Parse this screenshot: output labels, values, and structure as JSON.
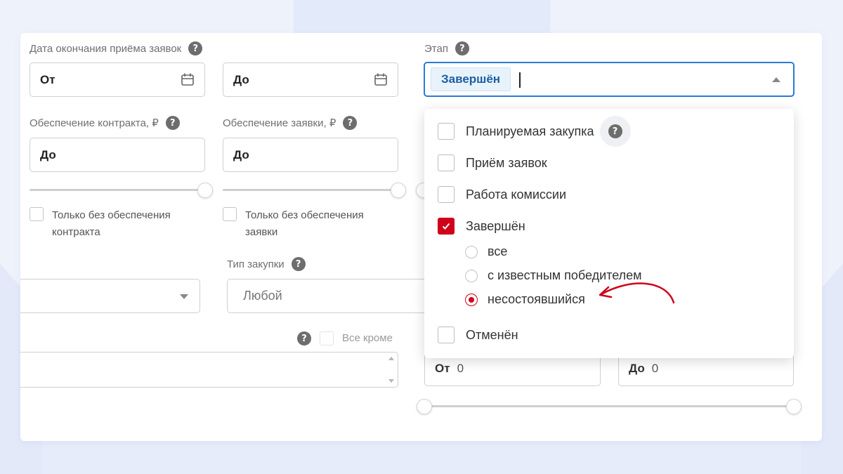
{
  "filters": {
    "deadline": {
      "label": "Дата окончания приёма заявок",
      "from_placeholder": "От",
      "to_placeholder": "До"
    },
    "contract_security": {
      "label": "Обеспечение контракта, ₽",
      "value": "До",
      "checkbox_label": "Только без обеспечения контракта"
    },
    "bid_security": {
      "label": "Обеспечение заявки, ₽",
      "value": "До",
      "checkbox_label": "Только без обеспечения заявки"
    },
    "purchase_type": {
      "label": "Тип закупки",
      "value": "Любой"
    },
    "all_except_label": "Все кроме",
    "price_range": {
      "from_label": "От",
      "from_value": "0",
      "to_label": "До",
      "to_value": "0"
    }
  },
  "stage": {
    "label": "Этап",
    "selected_chip": "Завершён",
    "options": [
      {
        "label": "Планируемая закупка",
        "checked": false
      },
      {
        "label": "Приём заявок",
        "checked": false
      },
      {
        "label": "Работа комиссии",
        "checked": false
      },
      {
        "label": "Завершён",
        "checked": true
      },
      {
        "label": "Отменён",
        "checked": false
      }
    ],
    "completed_suboptions": [
      {
        "label": "все",
        "selected": false
      },
      {
        "label": "с известным победителем",
        "selected": false
      },
      {
        "label": "несостоявшийся",
        "selected": true
      }
    ]
  },
  "colors": {
    "accent": "#2b7ad6",
    "checked": "#d0021b",
    "annotation_arrow": "#d0021b"
  },
  "icons": {
    "help": "?"
  }
}
